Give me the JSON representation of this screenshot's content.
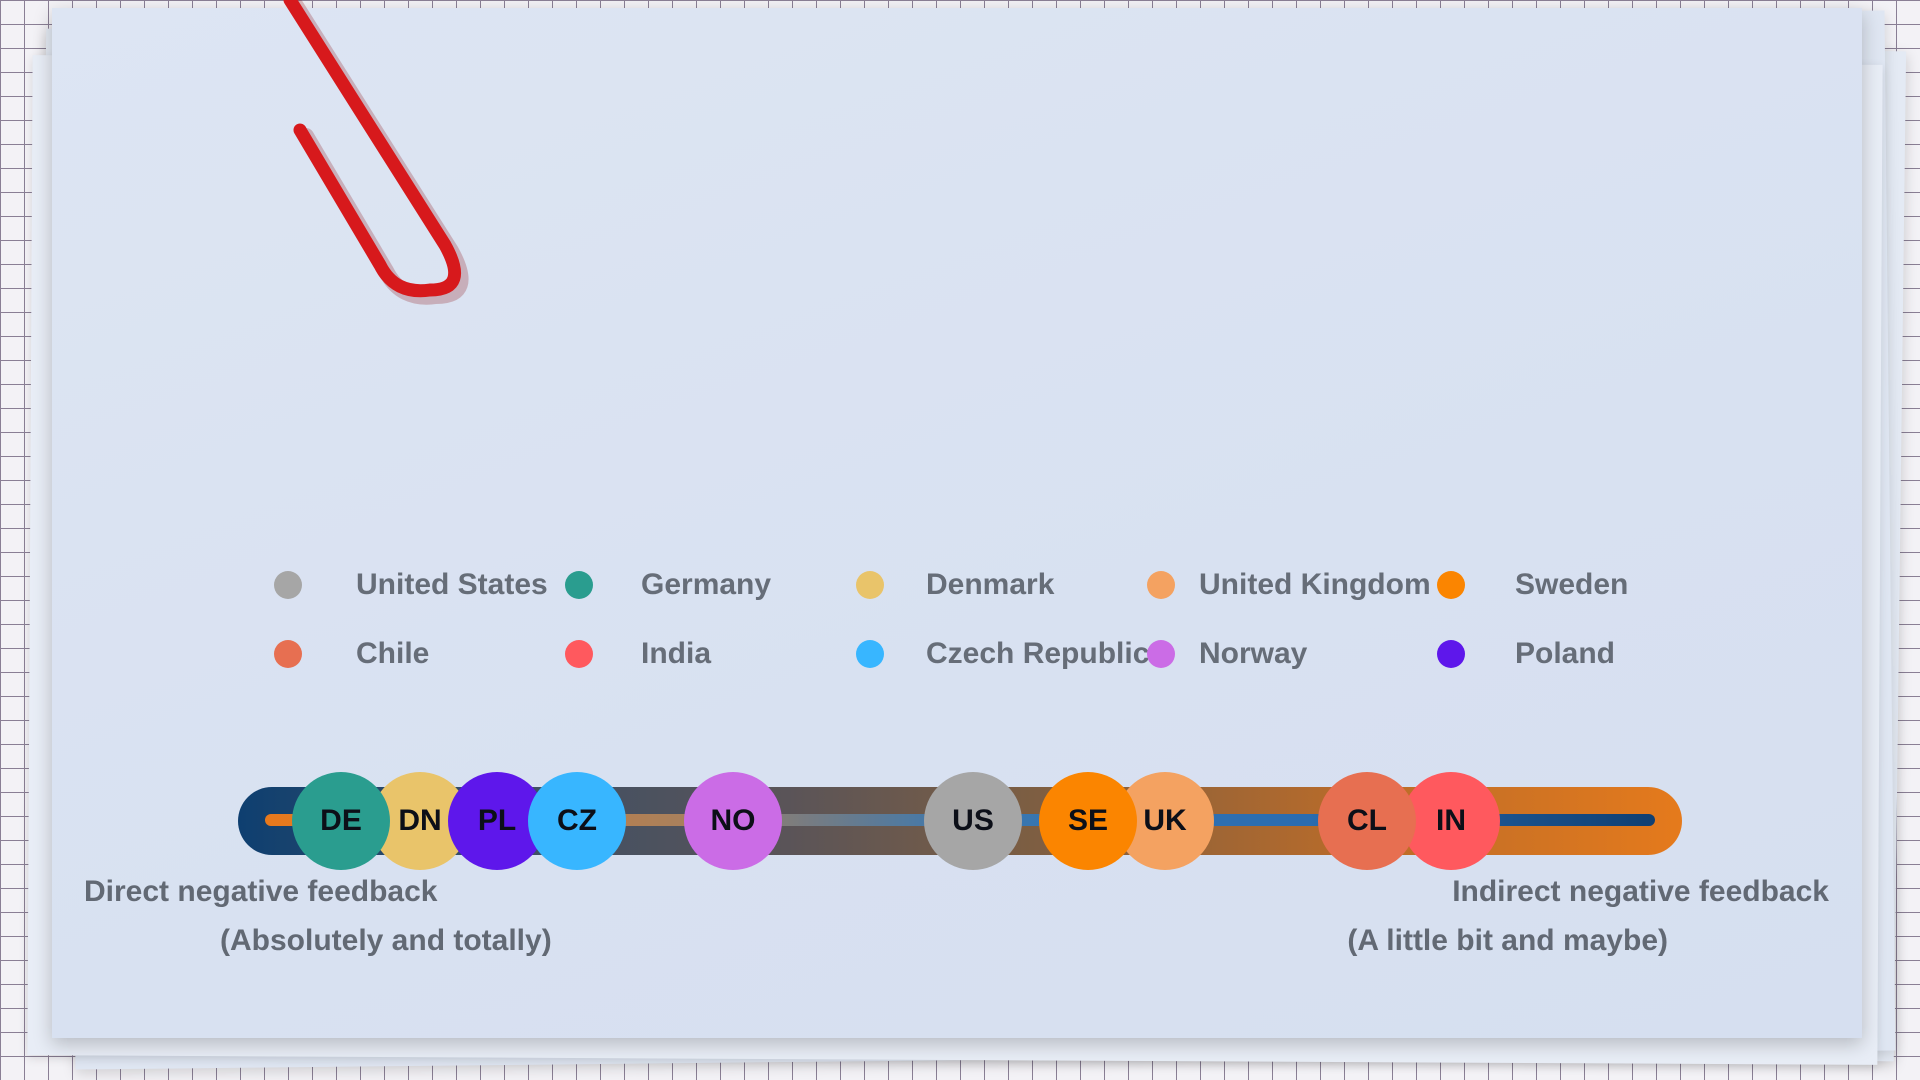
{
  "legend": [
    {
      "label": "United States",
      "color": "#a6a6a6"
    },
    {
      "label": "Germany",
      "color": "#2a9d8f"
    },
    {
      "label": "Denmark",
      "color": "#e9c46a"
    },
    {
      "label": "United Kingdom",
      "color": "#f4a261"
    },
    {
      "label": "Sweden",
      "color": "#fb8500"
    },
    {
      "label": "Chile",
      "color": "#e76f51"
    },
    {
      "label": "India",
      "color": "#ff595e"
    },
    {
      "label": "Czech Republic",
      "color": "#38b6ff"
    },
    {
      "label": "Norway",
      "color": "#cb6ce6"
    },
    {
      "label": "Poland",
      "color": "#5e17eb"
    }
  ],
  "scale": {
    "left_label": "Direct negative feedback",
    "left_sublabel": "(Absolutely and totally)",
    "right_label": "Indirect negative feedback",
    "right_sublabel": "(A little bit and maybe)"
  },
  "countries": [
    {
      "code": "DE",
      "color": "#2a9d8f"
    },
    {
      "code": "DN",
      "color": "#e9c46a"
    },
    {
      "code": "PL",
      "color": "#5e17eb"
    },
    {
      "code": "CZ",
      "color": "#38b6ff"
    },
    {
      "code": "NO",
      "color": "#cb6ce6"
    },
    {
      "code": "US",
      "color": "#a6a6a6"
    },
    {
      "code": "SE",
      "color": "#fb8500"
    },
    {
      "code": "UK",
      "color": "#f4a261"
    },
    {
      "code": "CL",
      "color": "#e76f51"
    },
    {
      "code": "IN",
      "color": "#ff595e"
    }
  ],
  "icons": {
    "clip": "paperclip-icon",
    "clip_color": "#d7191c"
  }
}
